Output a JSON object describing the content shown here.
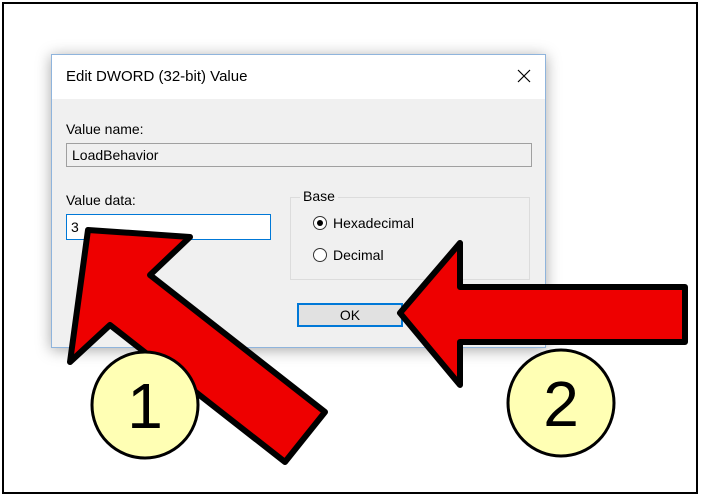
{
  "dialog": {
    "title": "Edit DWORD (32-bit) Value",
    "close_icon": "close-icon",
    "value_name_label": "Value name:",
    "value_name": "LoadBehavior",
    "value_data_label": "Value data:",
    "value_data": "3",
    "base": {
      "legend": "Base",
      "options": [
        {
          "label": "Hexadecimal",
          "selected": true
        },
        {
          "label": "Decimal",
          "selected": false
        }
      ]
    },
    "ok_label": "OK"
  },
  "annotations": {
    "arrow_color": "#ee0000",
    "badge_color": "#ffffb4",
    "steps": [
      {
        "number": "1"
      },
      {
        "number": "2"
      }
    ]
  }
}
